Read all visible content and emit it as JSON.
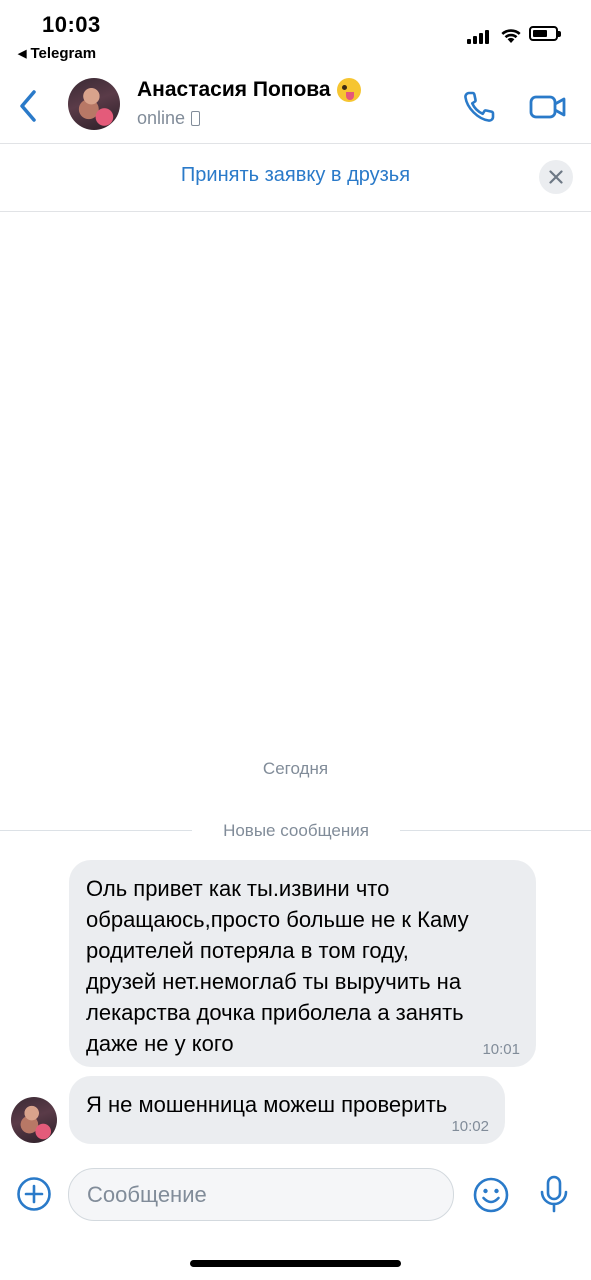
{
  "status_bar": {
    "time": "10:03",
    "back_app_label": "Telegram"
  },
  "header": {
    "contact_name": "Анастасия Попова",
    "presence": "online",
    "name_emoji_icon": "tongue-out-face-icon"
  },
  "friend_request": {
    "accept_label": "Принять заявку в друзья"
  },
  "chat": {
    "date_separator": "Сегодня",
    "new_messages_label": "Новые сообщения",
    "messages": [
      {
        "text": "Оль привет как ты.извини что\nобращаюсь,просто больше не к Каму\nродителей потеряла в том году,\nдрузей нет.немоглаб ты выручить на\nлекарства дочка приболела а занять\nдаже не у кого",
        "time": "10:01"
      },
      {
        "text": "Я не мошенница можеш проверить",
        "time": "10:02"
      }
    ]
  },
  "composer": {
    "placeholder": "Сообщение"
  },
  "colors": {
    "accent": "#2a7ac9",
    "bubble": "#ebedf0",
    "secondary_text": "#818c99"
  }
}
